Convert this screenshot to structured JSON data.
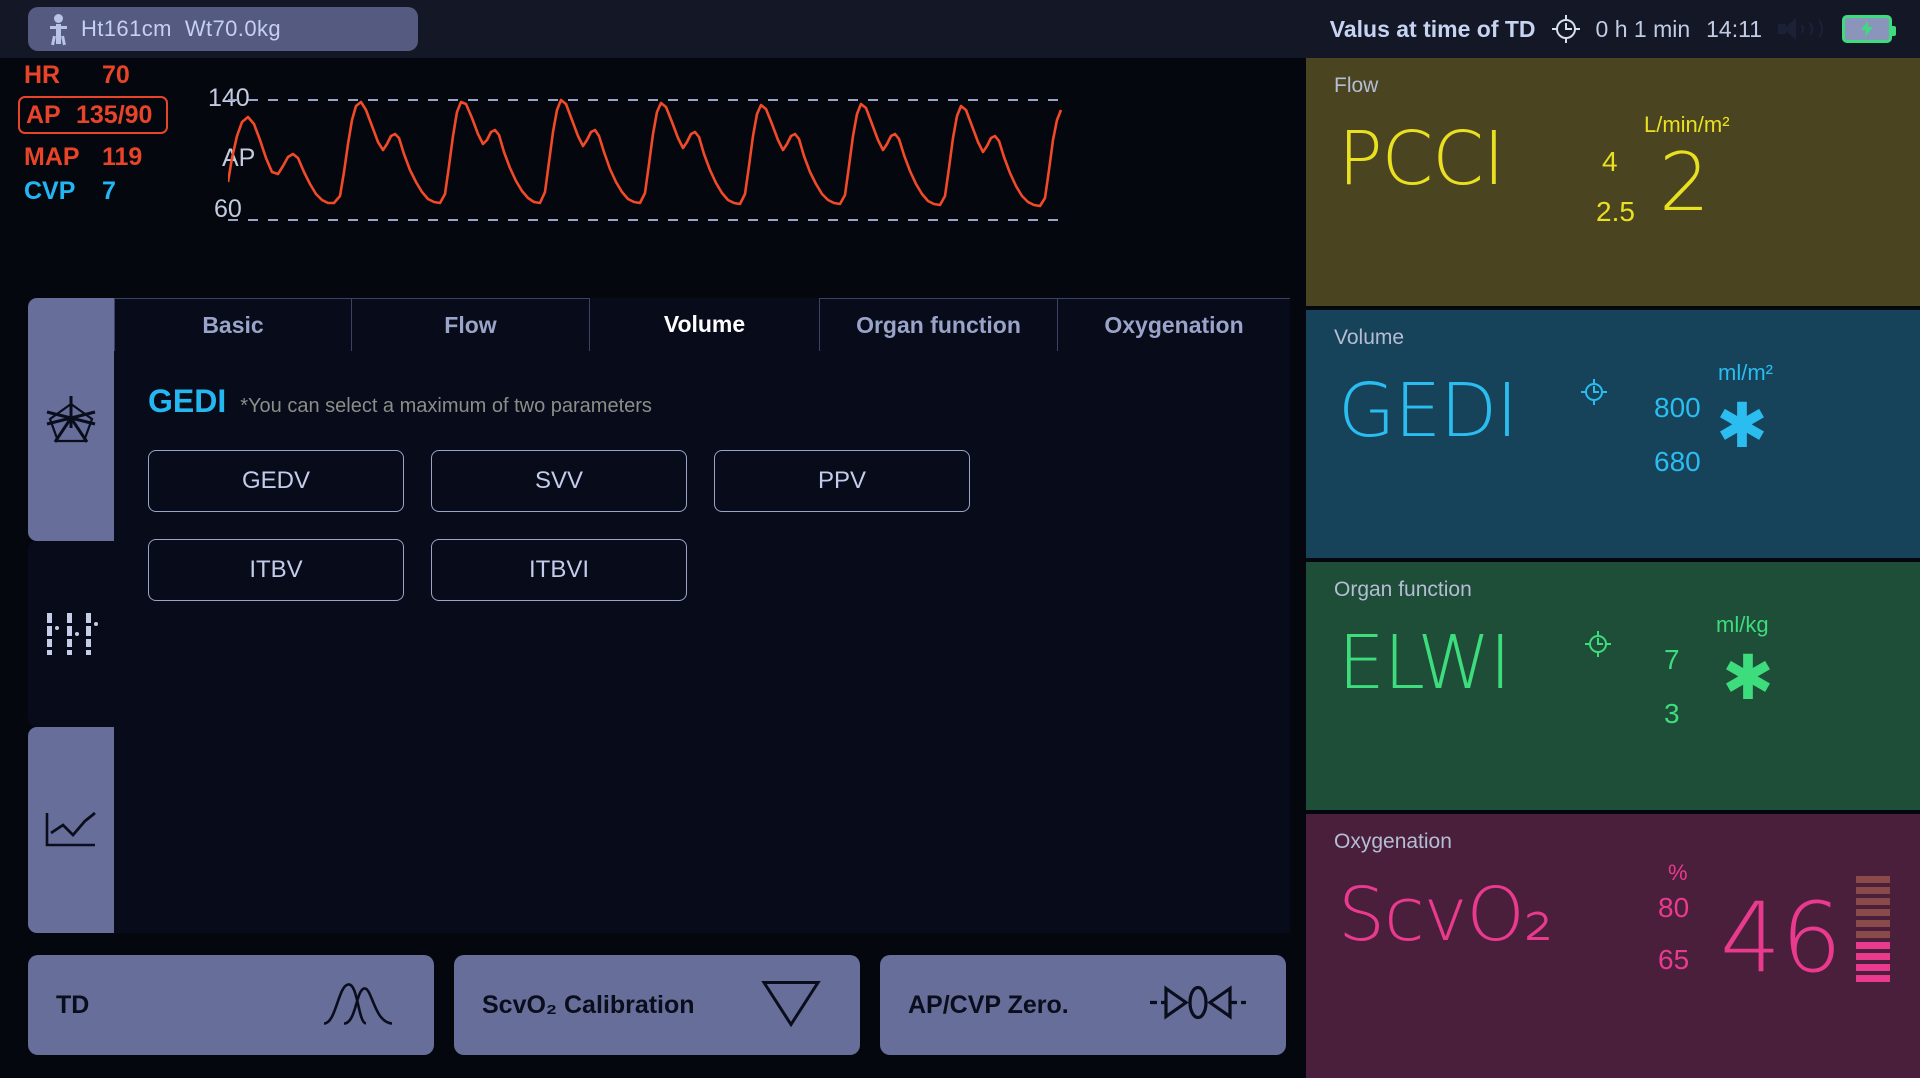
{
  "header": {
    "patient": {
      "icon": "person-icon",
      "text": "Ht161cm  Wt70.0kg"
    },
    "td_label": "Valus at time of TD",
    "clock_icon": "td-clock-icon",
    "elapsed": "0 h 1 min",
    "time": "14:11",
    "speaker_icon": "speaker-icon",
    "battery_icon": "battery-charging-icon"
  },
  "vitals": [
    {
      "label": "HR",
      "value": "70",
      "color": "#e8442a",
      "boxed": false
    },
    {
      "label": "AP",
      "value": "135/90",
      "color": "#e8442a",
      "boxed": true
    },
    {
      "label": "MAP",
      "value": "119",
      "color": "#e8442a",
      "boxed": false
    },
    {
      "label": "CVP",
      "value": "7",
      "color": "#22b6f5",
      "boxed": false
    }
  ],
  "waveform": {
    "top_label": "140",
    "mid_label": "AP",
    "bottom_label": "60",
    "trace_color": "#f24a28",
    "gridline_color": "#9aa4c8"
  },
  "side_rail": [
    {
      "name": "radar-chart-icon",
      "active": true
    },
    {
      "name": "columns-chart-icon",
      "active": false
    },
    {
      "name": "trend-line-chart-icon",
      "active": true
    }
  ],
  "tabs": [
    {
      "label": "Basic",
      "active": false
    },
    {
      "label": "Flow",
      "active": false
    },
    {
      "label": "Volume",
      "active": true
    },
    {
      "label": "Organ function",
      "active": false
    },
    {
      "label": "Oxygenation",
      "active": false
    }
  ],
  "content": {
    "title": "GEDI",
    "title_color": "#25b7f0",
    "note": "*You can select a maximum of two parameters",
    "params": [
      "GEDV",
      "SVV",
      "PPV",
      "ITBV",
      "ITBVI"
    ]
  },
  "bottom_buttons": [
    {
      "label": "TD",
      "icon": "td-curve-icon"
    },
    {
      "label": "ScvO₂ Calibration",
      "icon": "triangle-down-icon"
    },
    {
      "label": "AP/CVP Zero.",
      "icon": "zero-arrows-icon"
    }
  ],
  "right_panels": [
    {
      "category": "Flow",
      "name": "PCCI",
      "color": "#e8e020",
      "bg": "#4a4420",
      "unit": "L/min/m²",
      "high": "4",
      "low": "2.5",
      "value": "2",
      "has_td_clock": false,
      "has_star": false,
      "has_bars": false
    },
    {
      "category": "Volume",
      "name": "GEDI",
      "color": "#2bbcf0",
      "bg": "#164359",
      "unit": "ml/m²",
      "high": "800",
      "low": "680",
      "value": "✱",
      "has_td_clock": true,
      "has_star": true,
      "has_bars": false
    },
    {
      "category": "Organ function",
      "name": "ELWI",
      "color": "#3ddc7d",
      "bg": "#1e4d38",
      "unit": "ml/kg",
      "high": "7",
      "low": "3",
      "value": "✱",
      "has_td_clock": true,
      "has_star": true,
      "has_bars": false
    },
    {
      "category": "Oxygenation",
      "name": "ScvO₂",
      "color": "#ea3a8e",
      "bg": "#4a1f3c",
      "unit": "%",
      "high": "80",
      "low": "65",
      "value": "46",
      "has_td_clock": false,
      "has_star": false,
      "has_bars": true
    }
  ]
}
